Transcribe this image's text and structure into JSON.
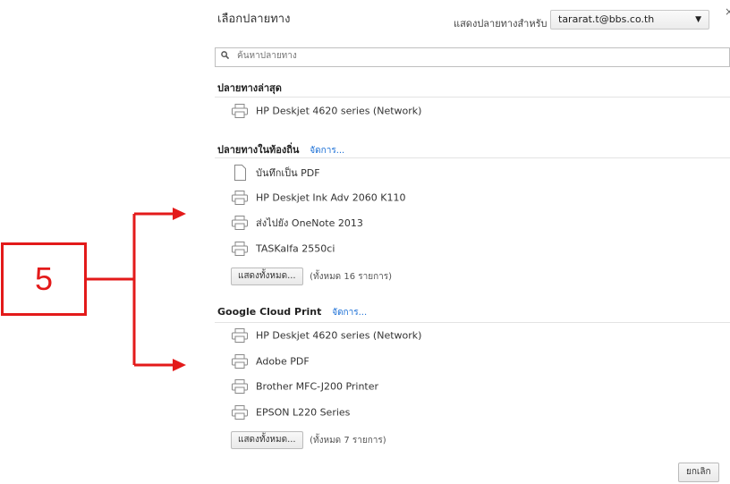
{
  "dialog": {
    "title": "เลือกปลายทาง",
    "close_glyph": "×",
    "show_for_label": "แสดงปลายทางสำหรับ",
    "account": "tararat.t@bbs.co.th",
    "search_placeholder": "ค้นหาปลายทาง",
    "cancel_label": "ยกเลิก"
  },
  "recent": {
    "heading": "ปลายทางล่าสุด",
    "items": [
      {
        "label": "HP Deskjet 4620 series (Network)",
        "icon": "printer-icon"
      }
    ]
  },
  "local": {
    "heading": "ปลายทางในท้องถิ่น",
    "manage_label": "จัดการ...",
    "items": [
      {
        "label": "บันทึกเป็น PDF",
        "icon": "document-icon"
      },
      {
        "label": "HP Deskjet Ink Adv 2060 K110",
        "icon": "printer-icon"
      },
      {
        "label": "ส่งไปยัง OneNote 2013",
        "icon": "printer-icon"
      },
      {
        "label": "TASKalfa 2550ci",
        "icon": "printer-icon"
      }
    ],
    "show_all_label": "แสดงทั้งหมด...",
    "total_label": "(ทั้งหมด 16 รายการ)"
  },
  "cloud": {
    "heading": "Google Cloud Print",
    "manage_label": "จัดการ...",
    "items": [
      {
        "label": "HP Deskjet 4620 series (Network)",
        "icon": "printer-icon"
      },
      {
        "label": "Adobe PDF",
        "icon": "printer-icon"
      },
      {
        "label": "Brother MFC-J200 Printer",
        "icon": "printer-icon"
      },
      {
        "label": "EPSON L220 Series",
        "icon": "printer-icon"
      }
    ],
    "show_all_label": "แสดงทั้งหมด...",
    "total_label": "(ทั้งหมด 7 รายการ)"
  },
  "annotation": {
    "number": "5",
    "color": "#e31a1a"
  }
}
